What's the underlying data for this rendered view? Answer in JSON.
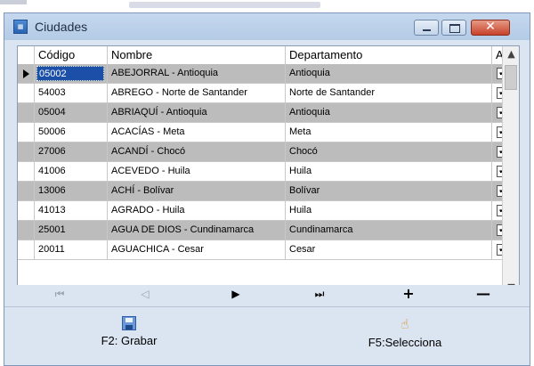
{
  "window": {
    "title": "Ciudades",
    "app_icon": "city-app-icon",
    "controls": {
      "minimize": "minimize-icon",
      "maximize": "maximize-icon",
      "close": "close-icon",
      "close_glyph": "✕"
    }
  },
  "grid": {
    "columns": [
      "Código",
      "Nombre",
      "Departamento",
      "Ac"
    ],
    "rows": [
      {
        "codigo": "05002",
        "nombre": "ABEJORRAL - Antioquia",
        "departamento": "Antioquia",
        "activo": true
      },
      {
        "codigo": "54003",
        "nombre": "ABREGO - Norte de Santander",
        "departamento": "Norte de Santander",
        "activo": true
      },
      {
        "codigo": "05004",
        "nombre": "ABRIAQUÍ - Antioquia",
        "departamento": "Antioquia",
        "activo": true
      },
      {
        "codigo": "50006",
        "nombre": "ACACÍAS - Meta",
        "departamento": "Meta",
        "activo": true
      },
      {
        "codigo": "27006",
        "nombre": "ACANDÍ - Chocó",
        "departamento": "Chocó",
        "activo": true
      },
      {
        "codigo": "41006",
        "nombre": "ACEVEDO - Huila",
        "departamento": "Huila",
        "activo": true
      },
      {
        "codigo": "13006",
        "nombre": "ACHÍ - Bolívar",
        "departamento": "Bolívar",
        "activo": true
      },
      {
        "codigo": "41013",
        "nombre": "AGRADO - Huila",
        "departamento": "Huila",
        "activo": true
      },
      {
        "codigo": "25001",
        "nombre": "AGUA DE DIOS - Cundinamarca",
        "departamento": "Cundinamarca",
        "activo": true
      },
      {
        "codigo": "20011",
        "nombre": "AGUACHICA - Cesar",
        "departamento": "Cesar",
        "activo": true
      }
    ],
    "selected_row": 0,
    "checkmark": "✔"
  },
  "navigator": {
    "first": "⏮",
    "prev": "◁",
    "next": "▶",
    "last": "⏭",
    "add": "+",
    "delete": "—"
  },
  "scroll": {
    "up": "▲",
    "down": "▼"
  },
  "actions": {
    "save_label": "F2: Grabar",
    "select_label": "F5:Selecciona",
    "save_icon": "floppy-disk-icon",
    "select_icon": "hand-pointer-icon",
    "hand_glyph": "☝"
  },
  "colors": {
    "shade_row": "#bcbcbc",
    "selected_cell": "#1b4fa8",
    "window_bg": "#dbe5f1",
    "close_button": "#c8432a"
  }
}
